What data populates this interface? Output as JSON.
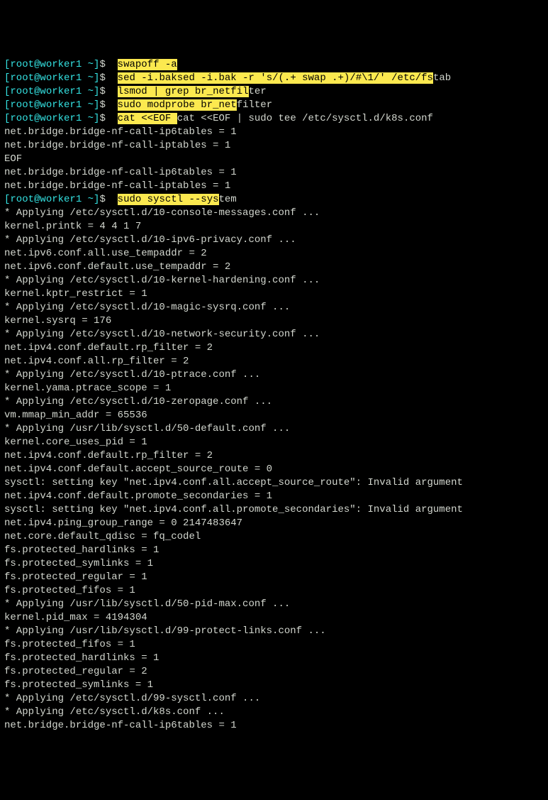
{
  "prompt": {
    "bracket_open": "[",
    "user": "root",
    "at": "@",
    "host": "worker1",
    "path": " ~",
    "bracket_close": "]",
    "dollar": "$ "
  },
  "lines": [
    {
      "type": "cmd",
      "parts": [
        {
          "t": " ",
          "c": "cmd"
        },
        {
          "t": "swapoff -a",
          "c": "highlight"
        }
      ]
    },
    {
      "type": "cmd",
      "parts": [
        {
          "t": " ",
          "c": "cmd"
        },
        {
          "t": "sed -i.bak",
          "c": "highlight"
        },
        {
          "t": "sed -i.bak -r 's/(.+ swap .+)/#\\1/' /etc/fs",
          "c": "highlight"
        },
        {
          "t": "tab",
          "c": "cmd"
        }
      ]
    },
    {
      "type": "cmd",
      "parts": [
        {
          "t": " ",
          "c": "cmd"
        },
        {
          "t": "lsmod | grep br_netfil",
          "c": "highlight"
        },
        {
          "t": "ter",
          "c": "cmd"
        }
      ]
    },
    {
      "type": "cmd",
      "parts": [
        {
          "t": " ",
          "c": "cmd"
        },
        {
          "t": "sudo modprobe br_net",
          "c": "highlight"
        },
        {
          "t": "filter",
          "c": "cmd"
        }
      ]
    },
    {
      "type": "cmd",
      "parts": [
        {
          "t": " ",
          "c": "cmd"
        },
        {
          "t": "cat <<EOF ",
          "c": "highlight"
        },
        {
          "t": "cat <<EOF | sudo tee /etc/sysctl.d/k8s.conf",
          "c": "cmd"
        }
      ]
    },
    {
      "type": "out",
      "text": "net.bridge.bridge-nf-call-ip6tables = 1"
    },
    {
      "type": "out",
      "text": "net.bridge.bridge-nf-call-iptables = 1"
    },
    {
      "type": "out",
      "text": "EOF"
    },
    {
      "type": "out",
      "text": "net.bridge.bridge-nf-call-ip6tables = 1"
    },
    {
      "type": "out",
      "text": "net.bridge.bridge-nf-call-iptables = 1"
    },
    {
      "type": "cmd",
      "parts": [
        {
          "t": " ",
          "c": "cmd"
        },
        {
          "t": "sudo sysctl --sys",
          "c": "highlight"
        },
        {
          "t": "tem",
          "c": "cmd"
        }
      ]
    },
    {
      "type": "out",
      "text": "* Applying /etc/sysctl.d/10-console-messages.conf ..."
    },
    {
      "type": "out",
      "text": "kernel.printk = 4 4 1 7"
    },
    {
      "type": "out",
      "text": "* Applying /etc/sysctl.d/10-ipv6-privacy.conf ..."
    },
    {
      "type": "out",
      "text": "net.ipv6.conf.all.use_tempaddr = 2"
    },
    {
      "type": "out",
      "text": "net.ipv6.conf.default.use_tempaddr = 2"
    },
    {
      "type": "out",
      "text": "* Applying /etc/sysctl.d/10-kernel-hardening.conf ..."
    },
    {
      "type": "out",
      "text": "kernel.kptr_restrict = 1"
    },
    {
      "type": "out",
      "text": "* Applying /etc/sysctl.d/10-magic-sysrq.conf ..."
    },
    {
      "type": "out",
      "text": "kernel.sysrq = 176"
    },
    {
      "type": "out",
      "text": "* Applying /etc/sysctl.d/10-network-security.conf ..."
    },
    {
      "type": "out",
      "text": "net.ipv4.conf.default.rp_filter = 2"
    },
    {
      "type": "out",
      "text": "net.ipv4.conf.all.rp_filter = 2"
    },
    {
      "type": "out",
      "text": "* Applying /etc/sysctl.d/10-ptrace.conf ..."
    },
    {
      "type": "out",
      "text": "kernel.yama.ptrace_scope = 1"
    },
    {
      "type": "out",
      "text": "* Applying /etc/sysctl.d/10-zeropage.conf ..."
    },
    {
      "type": "out",
      "text": "vm.mmap_min_addr = 65536"
    },
    {
      "type": "out",
      "text": "* Applying /usr/lib/sysctl.d/50-default.conf ..."
    },
    {
      "type": "out",
      "text": "kernel.core_uses_pid = 1"
    },
    {
      "type": "out",
      "text": "net.ipv4.conf.default.rp_filter = 2"
    },
    {
      "type": "out",
      "text": "net.ipv4.conf.default.accept_source_route = 0"
    },
    {
      "type": "out",
      "text": "sysctl: setting key \"net.ipv4.conf.all.accept_source_route\": Invalid argument"
    },
    {
      "type": "out",
      "text": "net.ipv4.conf.default.promote_secondaries = 1"
    },
    {
      "type": "out",
      "text": "sysctl: setting key \"net.ipv4.conf.all.promote_secondaries\": Invalid argument"
    },
    {
      "type": "out",
      "text": "net.ipv4.ping_group_range = 0 2147483647"
    },
    {
      "type": "out",
      "text": "net.core.default_qdisc = fq_codel"
    },
    {
      "type": "out",
      "text": "fs.protected_hardlinks = 1"
    },
    {
      "type": "out",
      "text": "fs.protected_symlinks = 1"
    },
    {
      "type": "out",
      "text": "fs.protected_regular = 1"
    },
    {
      "type": "out",
      "text": "fs.protected_fifos = 1"
    },
    {
      "type": "out",
      "text": "* Applying /usr/lib/sysctl.d/50-pid-max.conf ..."
    },
    {
      "type": "out",
      "text": "kernel.pid_max = 4194304"
    },
    {
      "type": "out",
      "text": "* Applying /usr/lib/sysctl.d/99-protect-links.conf ..."
    },
    {
      "type": "out",
      "text": "fs.protected_fifos = 1"
    },
    {
      "type": "out",
      "text": "fs.protected_hardlinks = 1"
    },
    {
      "type": "out",
      "text": "fs.protected_regular = 2"
    },
    {
      "type": "out",
      "text": "fs.protected_symlinks = 1"
    },
    {
      "type": "out",
      "text": "* Applying /etc/sysctl.d/99-sysctl.conf ..."
    },
    {
      "type": "out",
      "text": "* Applying /etc/sysctl.d/k8s.conf ..."
    },
    {
      "type": "out",
      "text": "net.bridge.bridge-nf-call-ip6tables = 1"
    }
  ]
}
